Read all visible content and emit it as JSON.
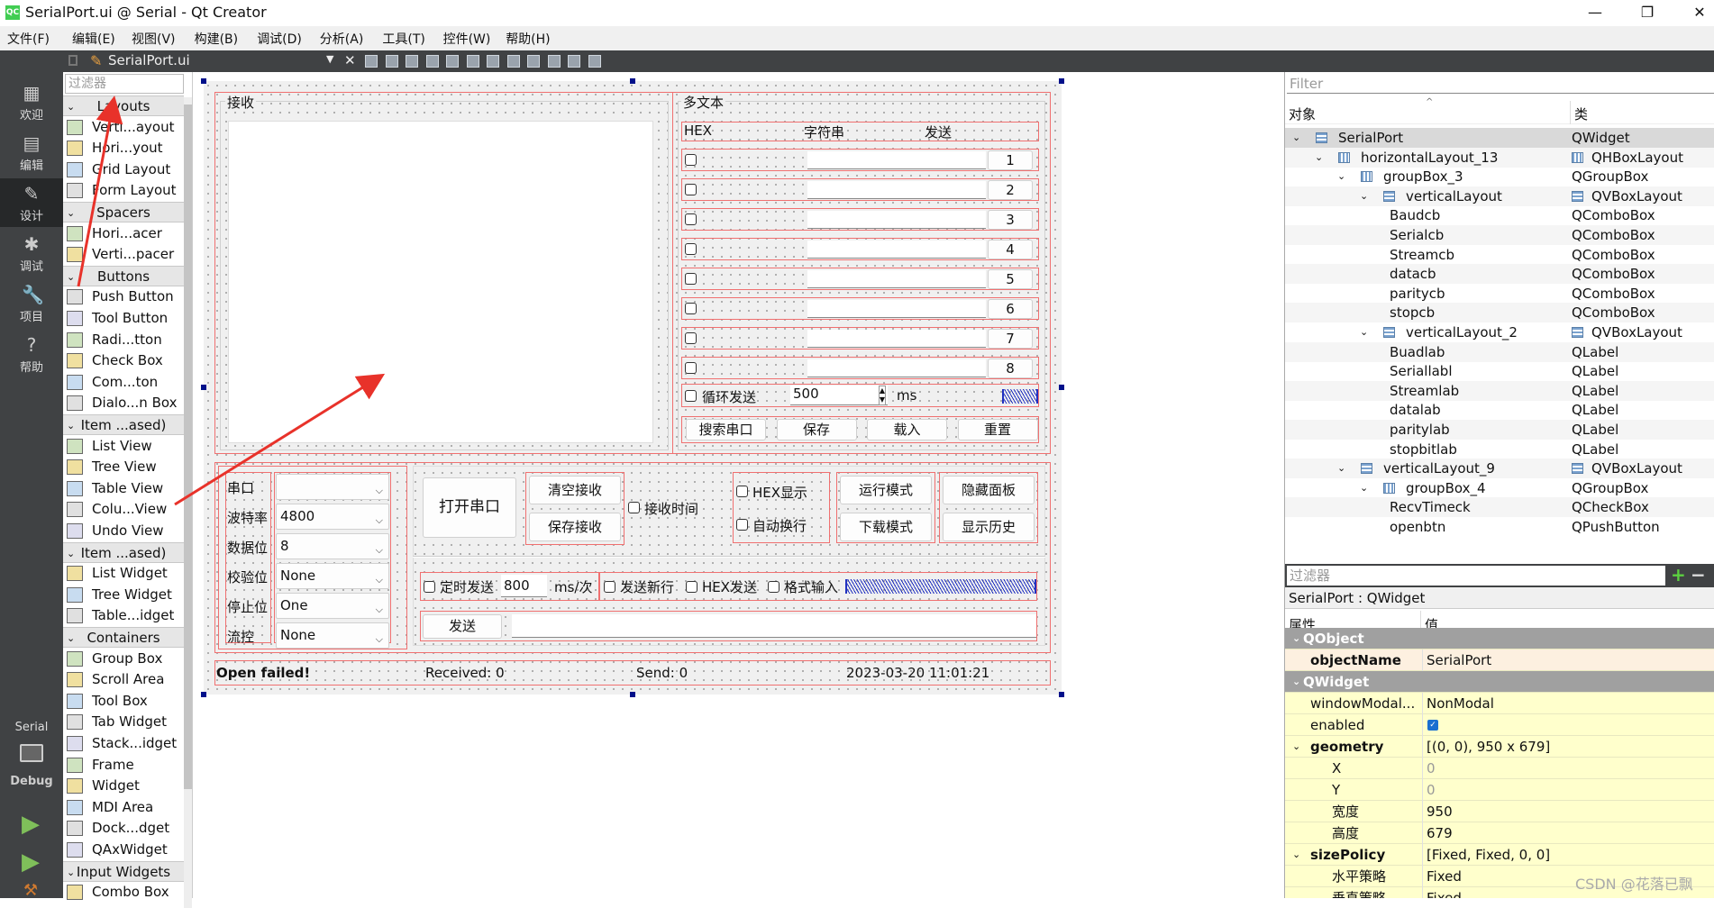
{
  "window": {
    "title": "SerialPort.ui @ Serial - Qt Creator",
    "minimize": "—",
    "maximize": "❐",
    "close": "✕"
  },
  "menu": [
    "文件(F)",
    "编辑(E)",
    "视图(V)",
    "构建(B)",
    "调试(D)",
    "分析(A)",
    "工具(T)",
    "控件(W)",
    "帮助(H)"
  ],
  "toolbar": {
    "file": "SerialPort.ui",
    "close": "✕"
  },
  "modes": [
    {
      "label": "欢迎",
      "icon": "grid-icon"
    },
    {
      "label": "编辑",
      "icon": "edit-icon"
    },
    {
      "label": "设计",
      "icon": "design-icon",
      "active": true
    },
    {
      "label": "调试",
      "icon": "bug-icon"
    },
    {
      "label": "项目",
      "icon": "wrench-icon"
    },
    {
      "label": "帮助",
      "icon": "help-icon"
    }
  ],
  "kit": {
    "project": "Serial",
    "config": "Debug"
  },
  "widgetbox": {
    "filter_placeholder": "过滤器",
    "items": [
      {
        "label": "Layouts",
        "header": true
      },
      {
        "label": "Verti...ayout"
      },
      {
        "label": "Hori...yout"
      },
      {
        "label": "Grid Layout"
      },
      {
        "label": "Form Layout"
      },
      {
        "label": "Spacers",
        "header": true
      },
      {
        "label": "Hori...acer"
      },
      {
        "label": "Verti...pacer"
      },
      {
        "label": "Buttons",
        "header": true
      },
      {
        "label": "Push Button"
      },
      {
        "label": "Tool Button"
      },
      {
        "label": "Radi...tton"
      },
      {
        "label": "Check Box"
      },
      {
        "label": "Com...ton"
      },
      {
        "label": "Dialo...n Box"
      },
      {
        "label": "Item ...ased)",
        "header": true
      },
      {
        "label": "List View"
      },
      {
        "label": "Tree View"
      },
      {
        "label": "Table View"
      },
      {
        "label": "Colu...View"
      },
      {
        "label": "Undo View"
      },
      {
        "label": "Item ...ased)",
        "header": true
      },
      {
        "label": "List Widget"
      },
      {
        "label": "Tree Widget"
      },
      {
        "label": "Table...idget"
      },
      {
        "label": "Containers",
        "header": true
      },
      {
        "label": "Group Box"
      },
      {
        "label": "Scroll Area"
      },
      {
        "label": "Tool Box"
      },
      {
        "label": "Tab Widget"
      },
      {
        "label": "Stack...idget"
      },
      {
        "label": "Frame"
      },
      {
        "label": "Widget"
      },
      {
        "label": "MDI Area"
      },
      {
        "label": "Dock...dget"
      },
      {
        "label": "QAxWidget"
      },
      {
        "label": "Input Widgets",
        "header": true
      },
      {
        "label": "Combo Box"
      }
    ]
  },
  "form": {
    "recv_title": "接收",
    "multi_title": "多文本",
    "multi_header": {
      "hex": "HEX",
      "string": "字符串",
      "send": "发送"
    },
    "multi_rows": [
      "1",
      "2",
      "3",
      "4",
      "5",
      "6",
      "7",
      "8"
    ],
    "loop_send": {
      "label": "循环发送",
      "value": "500",
      "unit": "ms"
    },
    "multi_buttons": [
      "搜索串口",
      "保存",
      "载入",
      "重置"
    ],
    "port_labels": [
      "串口",
      "波特率",
      "数据位",
      "校验位",
      "停止位",
      "流控"
    ],
    "port_values": [
      "",
      "4800",
      "8",
      "None",
      "One",
      "None"
    ],
    "open_port": "打开串口",
    "clear_recv": "清空接收",
    "save_recv": "保存接收",
    "recv_time": "接收时间",
    "hex_display": "HEX显示",
    "auto_wrap": "自动换行",
    "run_mode": "运行模式",
    "download_mode": "下载模式",
    "hide_panel": "隐藏面板",
    "show_history": "显示历史",
    "timed_send": {
      "label": "定时发送",
      "value": "800",
      "unit": "ms/次"
    },
    "send_newline": "发送新行",
    "hex_send": "HEX发送",
    "format_input": "格式输入",
    "send_button": "发送",
    "status": {
      "message": "Open failed!",
      "received": "Received: 0",
      "sent": "Send: 0",
      "datetime": "2023-03-20 11:01:21"
    }
  },
  "object_inspector": {
    "filter_placeholder": "Filter",
    "col_object": "对象",
    "col_class": "类",
    "rows": [
      {
        "name": "SerialPort",
        "cls": "QWidget",
        "level": 0,
        "expand": true,
        "icon": "vbox"
      },
      {
        "name": "horizontalLayout_13",
        "cls": "QHBoxLayout",
        "level": 1,
        "expand": true,
        "icon": "hbox",
        "clsicon": "hbox"
      },
      {
        "name": "groupBox_3",
        "cls": "QGroupBox",
        "level": 2,
        "expand": true,
        "icon": "hbox"
      },
      {
        "name": "verticalLayout",
        "cls": "QVBoxLayout",
        "level": 3,
        "expand": true,
        "icon": "vbox",
        "clsicon": "vbox"
      },
      {
        "name": "Baudcb",
        "cls": "QComboBox",
        "level": 4
      },
      {
        "name": "Serialcb",
        "cls": "QComboBox",
        "level": 4
      },
      {
        "name": "Streamcb",
        "cls": "QComboBox",
        "level": 4
      },
      {
        "name": "datacb",
        "cls": "QComboBox",
        "level": 4
      },
      {
        "name": "paritycb",
        "cls": "QComboBox",
        "level": 4
      },
      {
        "name": "stopcb",
        "cls": "QComboBox",
        "level": 4
      },
      {
        "name": "verticalLayout_2",
        "cls": "QVBoxLayout",
        "level": 3,
        "expand": true,
        "icon": "vbox",
        "clsicon": "vbox"
      },
      {
        "name": "Buadlab",
        "cls": "QLabel",
        "level": 4
      },
      {
        "name": "Seriallabl",
        "cls": "QLabel",
        "level": 4
      },
      {
        "name": "Streamlab",
        "cls": "QLabel",
        "level": 4
      },
      {
        "name": "datalab",
        "cls": "QLabel",
        "level": 4
      },
      {
        "name": "paritylab",
        "cls": "QLabel",
        "level": 4
      },
      {
        "name": "stopbitlab",
        "cls": "QLabel",
        "level": 4
      },
      {
        "name": "verticalLayout_9",
        "cls": "QVBoxLayout",
        "level": 2,
        "expand": true,
        "icon": "vbox",
        "clsicon": "vbox"
      },
      {
        "name": "groupBox_4",
        "cls": "QGroupBox",
        "level": 3,
        "expand": true,
        "icon": "hbox"
      },
      {
        "name": "RecvTimeck",
        "cls": "QCheckBox",
        "level": 4
      },
      {
        "name": "openbtn",
        "cls": "QPushButton",
        "level": 4
      }
    ]
  },
  "property_editor": {
    "filter_placeholder": "过滤器",
    "add": "+",
    "remove": "−",
    "context": "SerialPort : QWidget",
    "col_property": "属性",
    "col_value": "值",
    "rows": [
      {
        "name": "QObject",
        "type": "cat"
      },
      {
        "name": "objectName",
        "value": "SerialPort",
        "type": "obj",
        "bold": true
      },
      {
        "name": "QWidget",
        "type": "cat"
      },
      {
        "name": "windowModal...",
        "value": "NonModal"
      },
      {
        "name": "enabled",
        "value": "",
        "checkbox": true,
        "checked": true
      },
      {
        "name": "geometry",
        "value": "[(0, 0), 950 x 679]",
        "bold": true,
        "expand": true
      },
      {
        "name": "X",
        "value": "0",
        "sub": true,
        "grey": true
      },
      {
        "name": "Y",
        "value": "0",
        "sub": true,
        "grey": true
      },
      {
        "name": "宽度",
        "value": "950",
        "sub": true
      },
      {
        "name": "高度",
        "value": "679",
        "sub": true
      },
      {
        "name": "sizePolicy",
        "value": "[Fixed, Fixed, 0, 0]",
        "bold": true,
        "expand": true
      },
      {
        "name": "水平策略",
        "value": "Fixed",
        "sub": true
      },
      {
        "name": "垂直策略",
        "value": "Fixed",
        "sub": true
      }
    ]
  },
  "watermark": "CSDN @花落已飘",
  "colors": {
    "layout_outline": "#f07070",
    "spacer": "#2030c0",
    "annotation_arrow": "#e8322a",
    "property_bg": "#ffffcc",
    "category_bg": "#a0a0a0",
    "dark_chrome": "#404244"
  }
}
